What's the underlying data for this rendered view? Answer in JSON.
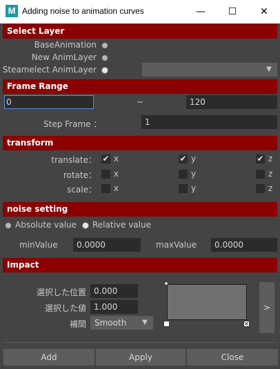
{
  "window": {
    "app_icon_letter": "M",
    "title": "Adding noise to animation curves",
    "minimize_icon": "minimize-icon",
    "maximize_icon": "maximize-icon",
    "close_icon": "close-icon"
  },
  "select_layer": {
    "header": "Select Layer",
    "options": [
      {
        "label": "BaseAnimation",
        "selected": false
      },
      {
        "label": "New AnimLayer",
        "selected": false
      },
      {
        "label": "Steamelect AnimLayer",
        "selected": true
      }
    ],
    "dropdown_value": "",
    "dropdown_arrow": "▼"
  },
  "frame_range": {
    "header": "Frame Range",
    "start": "0",
    "separator": "~",
    "end": "120",
    "step_label": "Step Frame ：",
    "step_value": "1"
  },
  "transform": {
    "header": "transform",
    "rows": [
      {
        "label": "translate：",
        "x": true,
        "y": true,
        "z": true
      },
      {
        "label": "rotate：",
        "x": false,
        "y": false,
        "z": false
      },
      {
        "label": "scale：",
        "x": false,
        "y": false,
        "z": false
      }
    ],
    "axis_labels": [
      "x",
      "y",
      "z"
    ],
    "check_mark": "✔"
  },
  "noise_setting": {
    "header": "noise setting",
    "mode_options": [
      {
        "label": "Absolute value",
        "selected": false
      },
      {
        "label": "Relative value",
        "selected": true
      }
    ],
    "min_label": "minValue",
    "min_value": "0.0000",
    "max_label": "maxValue",
    "max_value": "0.0000"
  },
  "impact": {
    "header": "Impact",
    "position_label": "選択した位置",
    "position_value": "0.000",
    "value_label": "選択した値",
    "value_value": "1.000",
    "interp_label": "補間",
    "interp_value": "Smooth",
    "interp_arrow": "▼",
    "expand_label": ">"
  },
  "buttons": {
    "add": "Add",
    "apply": "Apply",
    "close": "Close"
  }
}
